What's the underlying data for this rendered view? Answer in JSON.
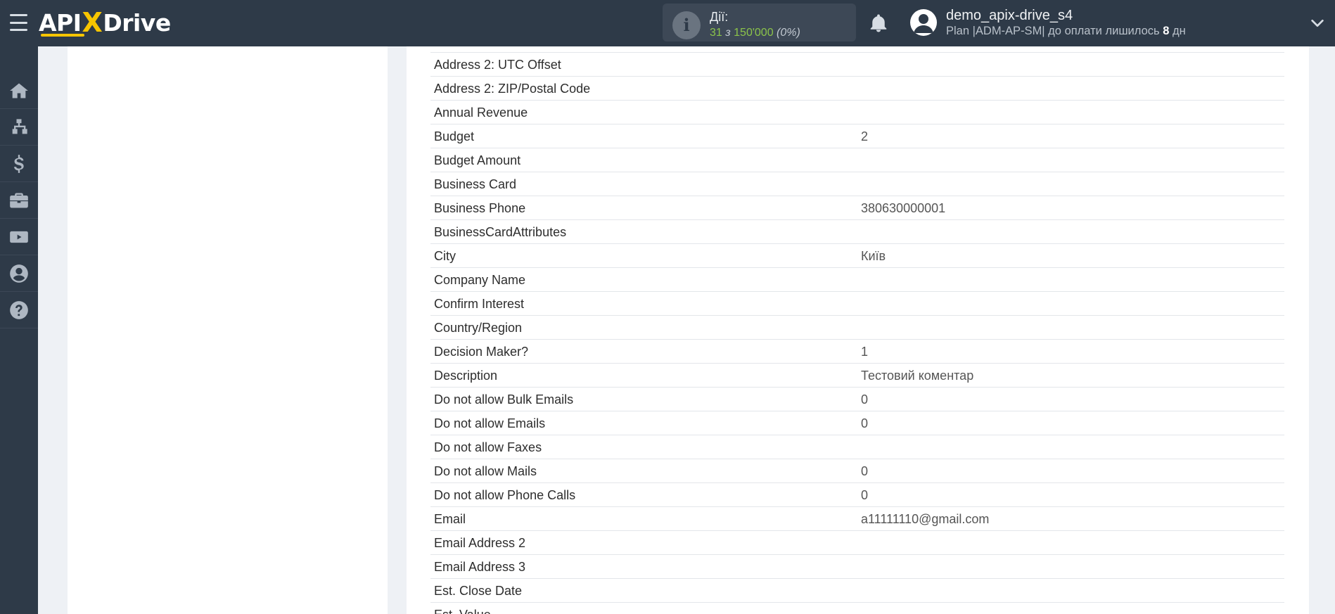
{
  "header": {
    "logo": {
      "text_left": "API",
      "text_x": "X",
      "text_right": "Drive"
    },
    "actions": {
      "label": "Дії:",
      "used": "31",
      "separator": "з",
      "total": "150'000",
      "percent": "(0%)"
    },
    "user": {
      "name": "demo_apix-drive_s4",
      "plan_prefix": "Plan |ADM-AP-SM| до оплати лишилось",
      "days": "8",
      "days_unit": "дн"
    },
    "icons": [
      "menu-icon",
      "info-icon",
      "bell-icon",
      "user-avatar-icon",
      "chevron-down-icon"
    ]
  },
  "sidebar": {
    "items": [
      {
        "name": "home",
        "icon": "home-icon"
      },
      {
        "name": "connections",
        "icon": "sitemap-icon"
      },
      {
        "name": "billing",
        "icon": "dollar-icon"
      },
      {
        "name": "services",
        "icon": "briefcase-icon"
      },
      {
        "name": "videos",
        "icon": "youtube-icon"
      },
      {
        "name": "account",
        "icon": "user-circle-icon"
      },
      {
        "name": "help",
        "icon": "question-circle-icon"
      }
    ]
  },
  "fields": [
    {
      "key": "Address 2: UTC Offset",
      "value": ""
    },
    {
      "key": "Address 2: ZIP/Postal Code",
      "value": ""
    },
    {
      "key": "Annual Revenue",
      "value": ""
    },
    {
      "key": "Budget",
      "value": "2"
    },
    {
      "key": "Budget Amount",
      "value": ""
    },
    {
      "key": "Business Card",
      "value": ""
    },
    {
      "key": "Business Phone",
      "value": "380630000001"
    },
    {
      "key": "BusinessCardAttributes",
      "value": ""
    },
    {
      "key": "City",
      "value": "Київ"
    },
    {
      "key": "Company Name",
      "value": ""
    },
    {
      "key": "Confirm Interest",
      "value": ""
    },
    {
      "key": "Country/Region",
      "value": ""
    },
    {
      "key": "Decision Maker?",
      "value": "1"
    },
    {
      "key": "Description",
      "value": "Тестовий коментар"
    },
    {
      "key": "Do not allow Bulk Emails",
      "value": "0"
    },
    {
      "key": "Do not allow Emails",
      "value": "0"
    },
    {
      "key": "Do not allow Faxes",
      "value": ""
    },
    {
      "key": "Do not allow Mails",
      "value": "0"
    },
    {
      "key": "Do not allow Phone Calls",
      "value": "0"
    },
    {
      "key": "Email",
      "value": "a11111110@gmail.com"
    },
    {
      "key": "Email Address 2",
      "value": ""
    },
    {
      "key": "Email Address 3",
      "value": ""
    },
    {
      "key": "Est. Close Date",
      "value": ""
    },
    {
      "key": "Est. Value",
      "value": ""
    }
  ]
}
